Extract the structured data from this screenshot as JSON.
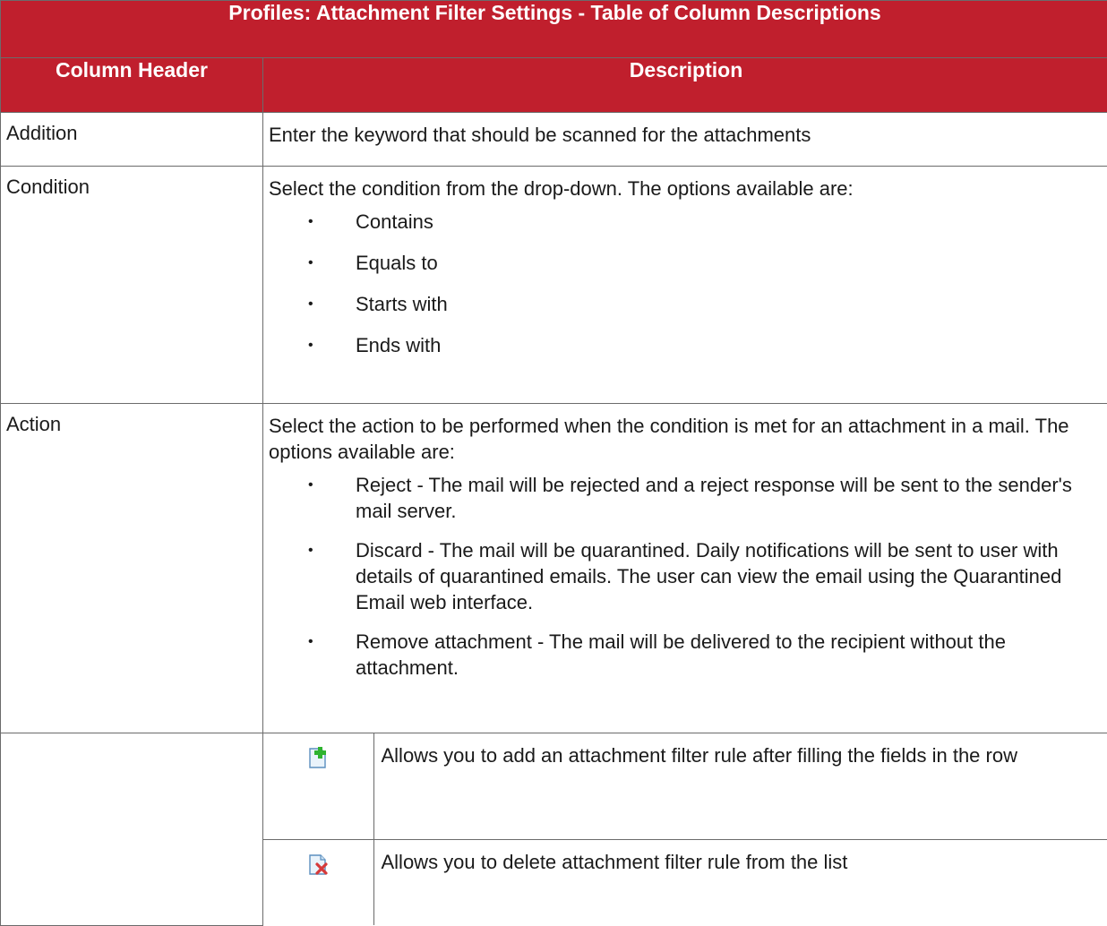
{
  "table": {
    "title": "Profiles: Attachment Filter Settings - Table of Column Descriptions",
    "headers": [
      "Column Header",
      "Description"
    ],
    "rows": {
      "addition": {
        "label": "Addition",
        "description": "Enter the keyword that should be scanned for the attachments"
      },
      "condition": {
        "label": "Condition",
        "description": "Select the condition from the drop-down. The options available are:",
        "options": [
          "Contains",
          "Equals to",
          "Starts with",
          "Ends with"
        ]
      },
      "action": {
        "label": "Action",
        "description": "Select the action to be performed when the condition is met for an attachment in a mail. The options available are:",
        "options": [
          "Reject - The mail will be rejected and a reject response will be sent to the sender's mail server.",
          "Discard - The mail will be quarantined. Daily notifications will be sent to user with details of quarantined emails. The user can view the email using the Quarantined Email web interface.",
          "Remove attachment - The mail will be delivered to the recipient without the attachment."
        ]
      },
      "controls": {
        "label": "",
        "items": [
          {
            "icon": "add-rule-icon",
            "description": "Allows you to add an attachment filter rule after filling the fields in the row"
          },
          {
            "icon": "delete-rule-icon",
            "description": "Allows you to delete attachment filter rule from the list"
          }
        ]
      }
    }
  },
  "colors": {
    "header_bg": "#c01f2d",
    "header_text": "#ffffff",
    "border": "#6b6b6b"
  }
}
